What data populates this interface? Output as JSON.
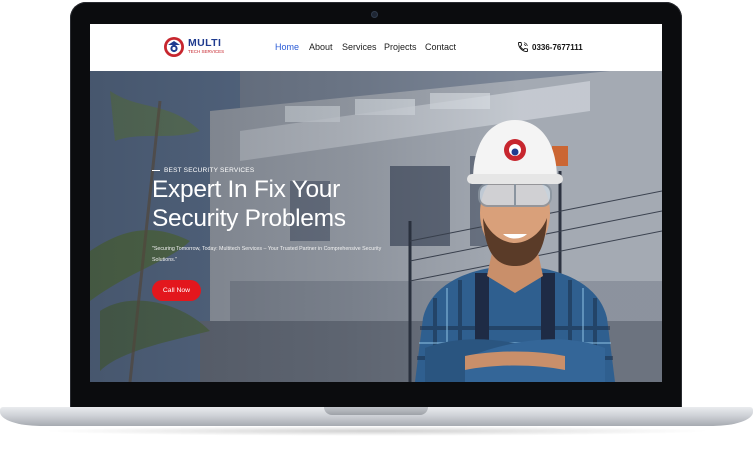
{
  "site": {
    "logo": {
      "name": "MULTI",
      "tagline": "TECH SERVICES"
    },
    "nav": [
      {
        "label": "Home",
        "active": true
      },
      {
        "label": "About",
        "active": false
      },
      {
        "label": "Services",
        "active": false
      },
      {
        "label": "Projects",
        "active": false
      },
      {
        "label": "Contact",
        "active": false
      }
    ],
    "phone": "0336-7677111"
  },
  "hero": {
    "eyebrow": "BEST SECURITY SERVICES",
    "title_line1": "Expert In Fix Your",
    "title_line2": "Security Problems",
    "quote": "\"Securing Tomorrow, Today: Multitech Services – Your Trusted Partner in Comprehensive Security Solutions.\"",
    "cta_label": "Call Now"
  },
  "colors": {
    "accent": "#e3171d",
    "nav_active": "#2a5bd7",
    "brand_blue": "#1f3b8f",
    "header_bg": "#ffffff"
  },
  "icons": {
    "logo": "camera-shield-icon",
    "phone": "phone-icon"
  }
}
